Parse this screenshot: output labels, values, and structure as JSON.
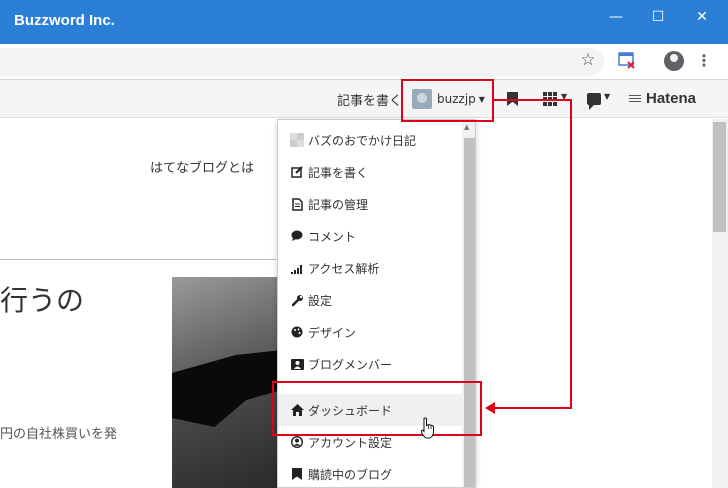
{
  "window": {
    "title": "Buzzword Inc."
  },
  "header": {
    "write_label": "記事を書く",
    "user_name": "buzzjp",
    "logo": "Hatena"
  },
  "page": {
    "about_link": "はてなブログとは",
    "headline": "行うの",
    "excerpt": "円の自社株買いを発"
  },
  "menu": {
    "items": [
      {
        "label": "バズのおでかけ日記",
        "icon": "blog-icon"
      },
      {
        "label": "記事を書く",
        "icon": "edit-icon"
      },
      {
        "label": "記事の管理",
        "icon": "document-icon"
      },
      {
        "label": "コメント",
        "icon": "comment-icon"
      },
      {
        "label": "アクセス解析",
        "icon": "signal-icon"
      },
      {
        "label": "設定",
        "icon": "wrench-icon"
      },
      {
        "label": "デザイン",
        "icon": "palette-icon"
      },
      {
        "label": "ブログメンバー",
        "icon": "members-icon"
      },
      {
        "label": "ダッシュボード",
        "icon": "home-icon"
      },
      {
        "label": "アカウント設定",
        "icon": "account-icon"
      },
      {
        "label": "購読中のブログ",
        "icon": "bookmark-icon"
      }
    ],
    "hovered_item": "ダッシュボード"
  },
  "colors": {
    "titlebar": "#2b7fd6",
    "annotation": "#e0001a"
  }
}
